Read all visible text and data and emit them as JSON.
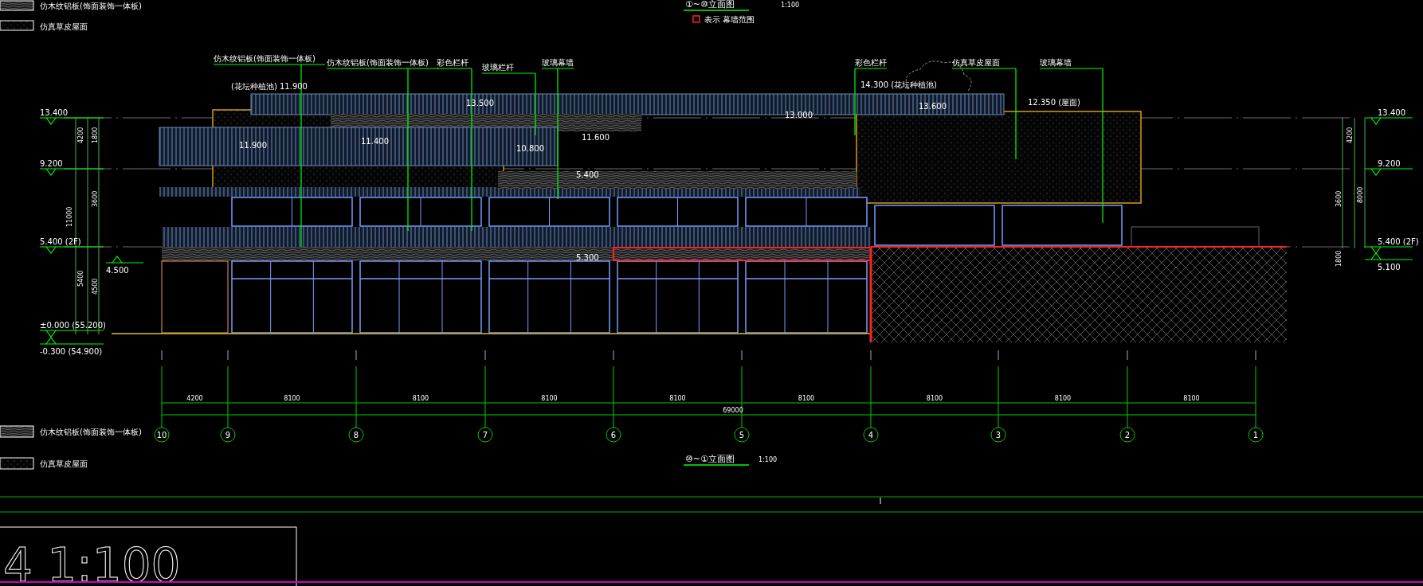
{
  "legend_top": [
    {
      "label": "仿木纹铝板(饰面装饰一体板)"
    },
    {
      "label": "仿真草皮屋面"
    }
  ],
  "title_top": {
    "label": "①~⑩立面图",
    "scale": "1:100",
    "note": "表示 幕墙范围"
  },
  "callouts": [
    {
      "label": "仿木纹铝板(饰面装饰一体板)"
    },
    {
      "label": "仿木纹铝板(饰面装饰一体板)"
    },
    {
      "label": "彩色栏杆"
    },
    {
      "label": "玻璃栏杆"
    },
    {
      "label": "玻璃幕墙"
    },
    {
      "label": "彩色栏杆"
    },
    {
      "label": "仿真草皮屋面"
    },
    {
      "label": "玻璃幕墙"
    }
  ],
  "building_levels": [
    {
      "label": "(花坛种植池) 11.900"
    },
    {
      "label": "13.500"
    },
    {
      "label": "11.900"
    },
    {
      "label": "11.400"
    },
    {
      "label": "10.800"
    },
    {
      "label": "11.600"
    },
    {
      "label": "13.000"
    },
    {
      "label": "14.300 (花坛种植池)"
    },
    {
      "label": "13.600"
    },
    {
      "label": "12.350 (屋面)"
    },
    {
      "label": "5.400"
    },
    {
      "label": "5.300"
    }
  ],
  "levels_left": [
    {
      "label": "13.400"
    },
    {
      "label": "9.200"
    },
    {
      "label": "5.400 (2F)"
    },
    {
      "label": "4.500"
    },
    {
      "label": "±0.000 (55.200)"
    },
    {
      "label": "-0.300 (54.900)"
    }
  ],
  "dims_left": [
    {
      "label": "4200"
    },
    {
      "label": "5400"
    },
    {
      "label": "11000"
    },
    {
      "label": "1800"
    },
    {
      "label": "3600"
    },
    {
      "label": "4500"
    }
  ],
  "levels_right": [
    {
      "label": "13.400"
    },
    {
      "label": "9.200"
    },
    {
      "label": "5.400 (2F)"
    },
    {
      "label": "5.100"
    }
  ],
  "dims_right": [
    {
      "label": "4200"
    },
    {
      "label": "3600"
    },
    {
      "label": "8000"
    },
    {
      "label": "1800"
    }
  ],
  "axes": [
    {
      "label": "10"
    },
    {
      "label": "9"
    },
    {
      "label": "8"
    },
    {
      "label": "7"
    },
    {
      "label": "6"
    },
    {
      "label": "5"
    },
    {
      "label": "4"
    },
    {
      "label": "3"
    },
    {
      "label": "2"
    },
    {
      "label": "1"
    }
  ],
  "axis_dims": [
    {
      "label": "4200"
    },
    {
      "label": "8100"
    },
    {
      "label": "8100"
    },
    {
      "label": "8100"
    },
    {
      "label": "8100"
    },
    {
      "label": "8100"
    },
    {
      "label": "8100"
    },
    {
      "label": "8100"
    },
    {
      "label": "8100"
    }
  ],
  "total_dim": "69000",
  "legend_bottom": [
    {
      "label": "仿木纹铝板(饰面装饰一体板)"
    },
    {
      "label": "仿真草皮屋面"
    }
  ],
  "title_bottom": {
    "label": "⑩~①立面图",
    "scale": "1:100"
  },
  "frame_text": "4  1:100"
}
